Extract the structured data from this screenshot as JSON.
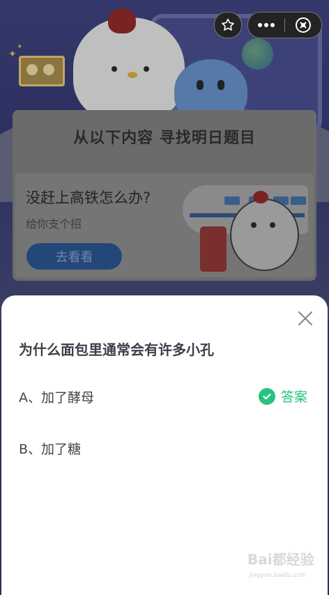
{
  "header": {
    "actions": [
      {
        "icon": "star-icon"
      },
      {
        "icon": "more-icon"
      },
      {
        "icon": "close-circle-icon"
      }
    ]
  },
  "panel": {
    "title": "从以下内容 寻找明日题目",
    "card": {
      "title": "没赶上高铁怎么办?",
      "subtitle": "给你支个招",
      "button_label": "去看看"
    }
  },
  "quiz": {
    "question": "为什么面包里通常会有许多小孔",
    "options": [
      {
        "label": "A、加了酵母",
        "is_answer": true
      },
      {
        "label": "B、加了糖",
        "is_answer": false
      }
    ],
    "answer_label": "答案",
    "accent_color": "#27c27f"
  },
  "watermark": {
    "text": "Bai都经验",
    "sub": "jingyan.baidu.com"
  }
}
